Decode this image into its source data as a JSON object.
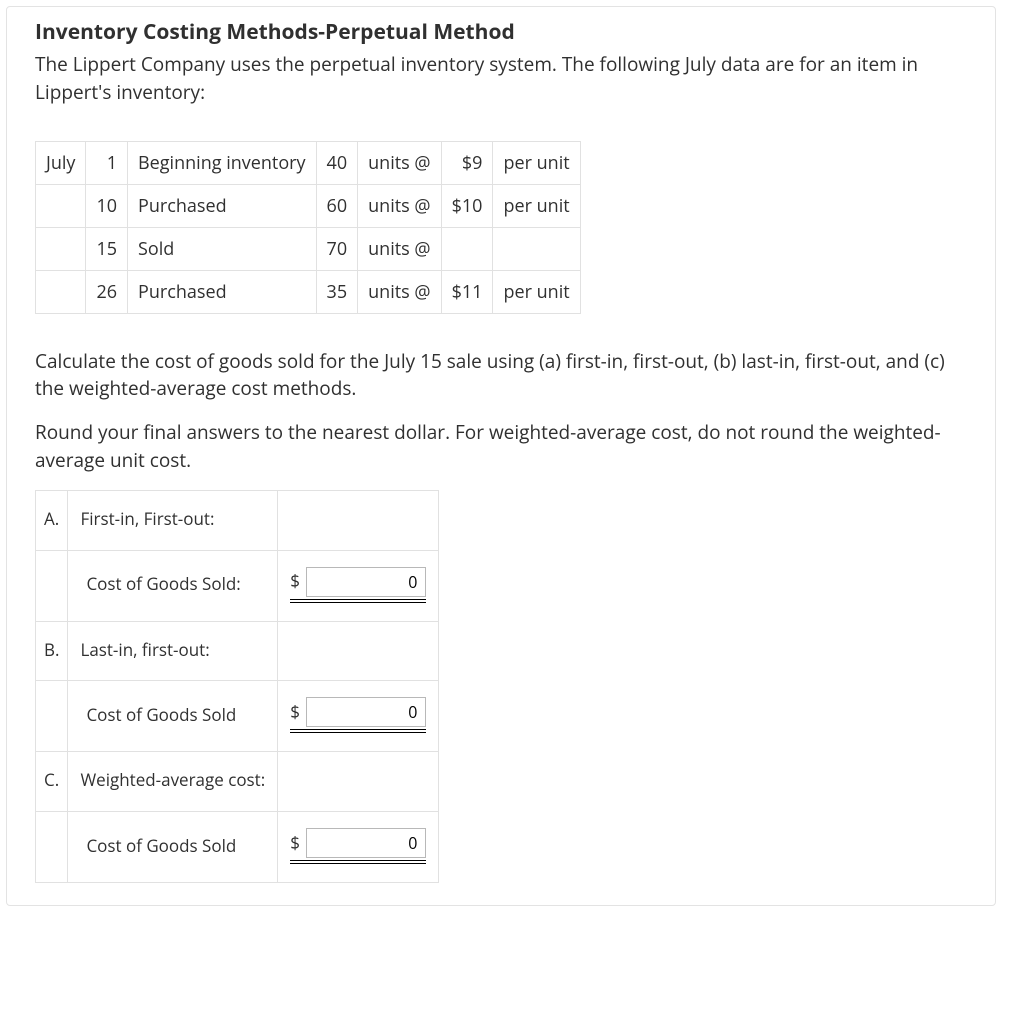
{
  "heading": "Inventory Costing Methods-Perpetual Method",
  "intro": "The Lippert Company uses the perpetual inventory system. The following July data are for an item in Lippert's inventory:",
  "data_rows": [
    {
      "month": "July",
      "day": "1",
      "desc": "Beginning inventory",
      "units": "40",
      "at": "units @",
      "price": "$9",
      "per": "per unit"
    },
    {
      "month": "",
      "day": "10",
      "desc": "Purchased",
      "units": "60",
      "at": "units @",
      "price": "$10",
      "per": "per unit"
    },
    {
      "month": "",
      "day": "15",
      "desc": "Sold",
      "units": "70",
      "at": "units @",
      "price": "",
      "per": ""
    },
    {
      "month": "",
      "day": "26",
      "desc": "Purchased",
      "units": "35",
      "at": "units @",
      "price": "$11",
      "per": "per unit"
    }
  ],
  "instr1": "Calculate the cost of goods sold for the July 15 sale using (a) first-in, first-out, (b) last-in, first-out, and (c) the weighted-average cost methods.",
  "instr2": "Round your final answers to the nearest dollar. For weighted-average cost, do not round the weighted-average unit cost.",
  "answers": {
    "a": {
      "letter": "A.",
      "title": "First-in, First-out:",
      "sub": "Cost of Goods Sold:",
      "currency": "$",
      "value": "0"
    },
    "b": {
      "letter": "B.",
      "title": "Last-in, first-out:",
      "sub": "Cost of Goods Sold",
      "currency": "$",
      "value": "0"
    },
    "c": {
      "letter": "C.",
      "title": "Weighted-average cost:",
      "sub": "Cost of Goods Sold",
      "currency": "$",
      "value": "0"
    }
  }
}
